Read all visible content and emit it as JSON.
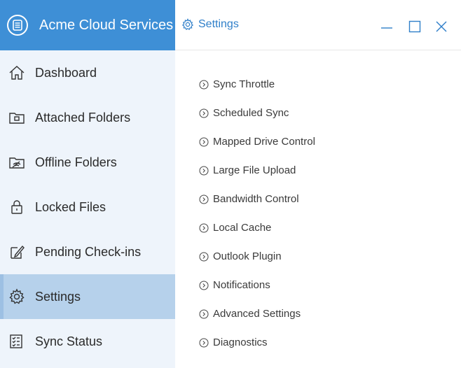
{
  "app": {
    "title": "Acme Cloud Services",
    "accent_color": "#3e8fd6",
    "logo_icon": "list-icon"
  },
  "sidebar": {
    "items": [
      {
        "label": "Dashboard",
        "icon": "home-icon",
        "active": false
      },
      {
        "label": "Attached Folders",
        "icon": "attached-folder-icon",
        "active": false
      },
      {
        "label": "Offline Folders",
        "icon": "offline-folder-icon",
        "active": false
      },
      {
        "label": "Locked Files",
        "icon": "lock-icon",
        "active": false
      },
      {
        "label": "Pending Check-ins",
        "icon": "pen-icon",
        "active": false
      },
      {
        "label": "Settings",
        "icon": "gear-icon",
        "active": true
      },
      {
        "label": "Sync Status",
        "icon": "checklist-icon",
        "active": false
      }
    ]
  },
  "header": {
    "title": "Settings",
    "icon": "gear-icon",
    "window_controls": [
      "minimize-icon",
      "maximize-icon",
      "close-icon"
    ]
  },
  "settings": {
    "items": [
      {
        "label": "Sync Throttle"
      },
      {
        "label": "Scheduled Sync"
      },
      {
        "label": "Mapped Drive Control"
      },
      {
        "label": "Large File Upload"
      },
      {
        "label": "Bandwidth Control"
      },
      {
        "label": "Local Cache"
      },
      {
        "label": "Outlook Plugin"
      },
      {
        "label": "Notifications"
      },
      {
        "label": "Advanced Settings"
      },
      {
        "label": "Diagnostics"
      }
    ]
  }
}
